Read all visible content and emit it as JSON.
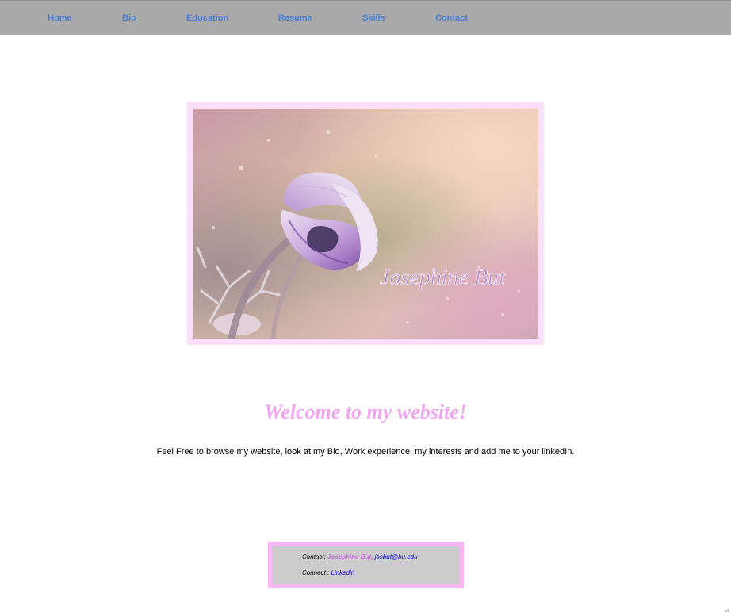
{
  "nav": {
    "items": [
      {
        "label": "Home"
      },
      {
        "label": "Bio"
      },
      {
        "label": "Education"
      },
      {
        "label": "Resume"
      },
      {
        "label": "Skills"
      },
      {
        "label": "Contact"
      }
    ]
  },
  "hero": {
    "signature": "Josephine  But"
  },
  "main": {
    "heading": "Welcome to my website!",
    "intro": "Feel Free to browse my website, look at my Bio, Work experience, my interests and add me to your linkedIn."
  },
  "footer": {
    "contact_label": "Contact:",
    "contact_name": "Josephine But,",
    "contact_email": "josbut@bu.edu",
    "connect_label": "Connect :",
    "connect_link": "Linkedin"
  },
  "colors": {
    "navbar_bg": "#a9a9a9",
    "nav_link": "#4a7fd6",
    "heading_pink": "#f3a6f0",
    "frame_pink": "#fce0fb",
    "footer_border": "#f7b5f5",
    "footer_bg": "#cccccc"
  }
}
